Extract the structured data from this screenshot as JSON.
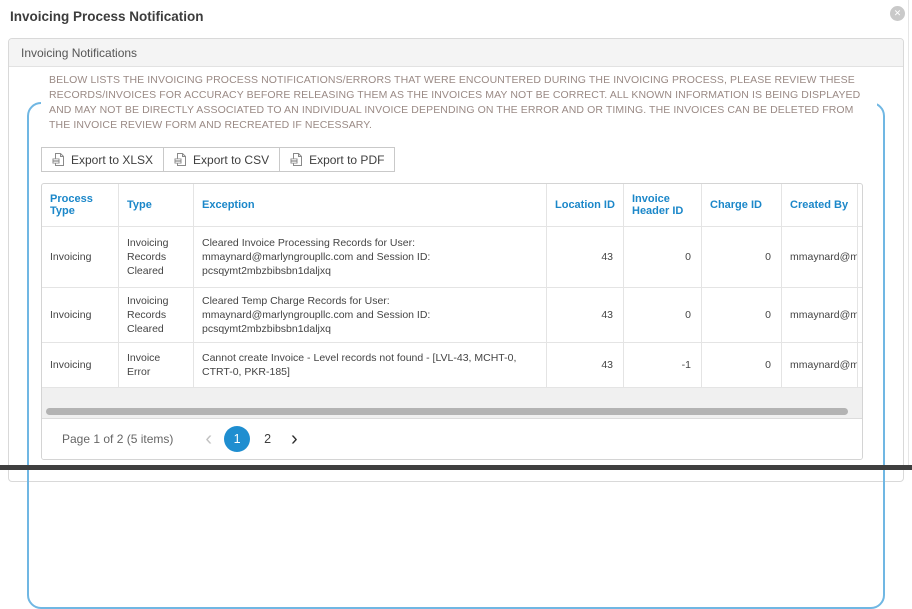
{
  "dialog": {
    "title": "Invoicing Process Notification"
  },
  "panel": {
    "title": "Invoicing Notifications"
  },
  "notice": "BELOW LISTS THE INVOICING PROCESS NOTIFICATIONS/ERRORS THAT WERE ENCOUNTERED DURING THE INVOICING PROCESS, PLEASE REVIEW THESE RECORDS/INVOICES FOR ACCURACY BEFORE RELEASING THEM AS THE INVOICES MAY NOT BE CORRECT. ALL KNOWN INFORMATION IS BEING DISPLAYED AND MAY NOT BE DIRECTLY ASSOCIATED TO AN INDIVIDUAL INVOICE DEPENDING ON THE ERROR AND OR TIMING. THE INVOICES CAN BE DELETED FROM THE INVOICE REVIEW FORM AND RECREATED IF NECESSARY.",
  "toolbar": {
    "export_xlsx": "Export to XLSX",
    "export_csv": "Export to CSV",
    "export_pdf": "Export to PDF"
  },
  "table": {
    "columns": [
      "Process Type",
      "Type",
      "Exception",
      "Location ID",
      "Invoice Header ID",
      "Charge ID",
      "Created By"
    ],
    "rows": [
      {
        "process_type": "Invoicing",
        "type": "Invoicing Records Cleared",
        "exception": "Cleared Invoice Processing Records for User: mmaynard@marlyngroupllc.com and Session ID: pcsqymt2mbzbibsbn1daljxq",
        "location_id": "43",
        "invoice_header_id": "0",
        "charge_id": "0",
        "created_by": "mmaynard@ma"
      },
      {
        "process_type": "Invoicing",
        "type": "Invoicing Records Cleared",
        "exception": "Cleared Temp Charge Records for User: mmaynard@marlyngroupllc.com and Session ID: pcsqymt2mbzbibsbn1daljxq",
        "location_id": "43",
        "invoice_header_id": "0",
        "charge_id": "0",
        "created_by": "mmaynard@ma"
      },
      {
        "process_type": "Invoicing",
        "type": "Invoice Error",
        "exception": "Cannot create Invoice - Level records not found - [LVL-43, MCHT-0, CTRT-0, PKR-185]",
        "location_id": "43",
        "invoice_header_id": "-1",
        "charge_id": "0",
        "created_by": "mmaynard@ma"
      }
    ]
  },
  "pager": {
    "summary": "Page 1 of 2 (5 items)",
    "prev": "‹",
    "pages": [
      "1",
      "2"
    ],
    "current_page": "1",
    "next": "›"
  },
  "icons": {
    "close": "✕"
  },
  "colors": {
    "accent_blue": "#1f8ed0",
    "header_text_blue": "#1b87c9",
    "frame_border_blue": "#70b7e3",
    "notice_text": "#9a8a85"
  }
}
